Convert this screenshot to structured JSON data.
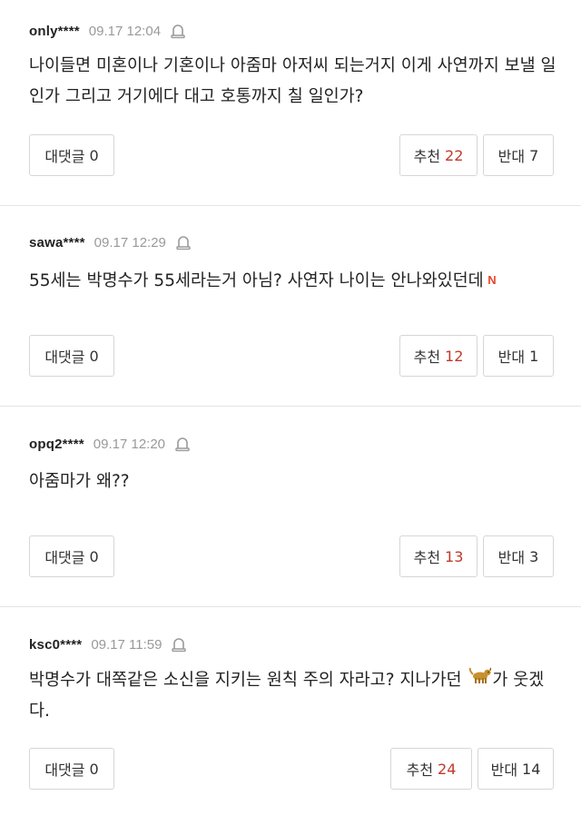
{
  "comments": [
    {
      "nick": "only****",
      "time": "09.17 12:04",
      "text": "나이들면 미혼이나 기혼이나 아줌마 아저씨 되는거지 이게 사연까지 보낼 일인가 그리고 거기에다 대고 호통까지 칠 일인가?",
      "reply_label": "대댓글",
      "reply_count": "0",
      "like_label": "추천",
      "like_count": "22",
      "dislike_label": "반대",
      "dislike_count": "7"
    },
    {
      "nick": "sawa****",
      "time": "09.17 12:29",
      "text": "55세는 박명수가 55세라는거 아님? 사연자 나이는 안나와있던데",
      "new_badge": "N",
      "reply_label": "대댓글",
      "reply_count": "0",
      "like_label": "추천",
      "like_count": "12",
      "dislike_label": "반대",
      "dislike_count": "1"
    },
    {
      "nick": "opq2****",
      "time": "09.17 12:20",
      "text": "아줌마가 왜??",
      "reply_label": "대댓글",
      "reply_count": "0",
      "like_label": "추천",
      "like_count": "13",
      "dislike_label": "반대",
      "dislike_count": "3"
    },
    {
      "nick": "ksc0****",
      "time": "09.17 11:59",
      "text_before": "박명수가 대쪽같은 소신을 지키는 원칙 주의 자라고? 지나가던",
      "text_after": "가 웃겠다.",
      "emoji_icon": "dog-icon",
      "reply_label": "대댓글",
      "reply_count": "0",
      "like_label": "추천",
      "like_count": "24",
      "dislike_label": "반대",
      "dislike_count": "14"
    }
  ],
  "colors": {
    "accent": "#c0392b",
    "border": "#d6d6d6",
    "muted": "#999999",
    "new_badge": "#e8472b"
  }
}
